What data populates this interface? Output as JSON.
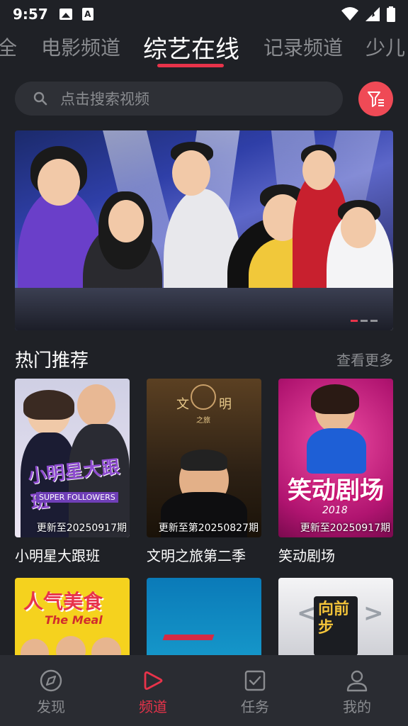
{
  "status": {
    "time": "9:57"
  },
  "tabs": [
    {
      "label": "全"
    },
    {
      "label": "电影频道"
    },
    {
      "label": "综艺在线",
      "active": true
    },
    {
      "label": "记录频道"
    },
    {
      "label": "少儿"
    }
  ],
  "search": {
    "placeholder": "点击搜索视频"
  },
  "banner": {
    "slides": 3,
    "active_slide": 1
  },
  "section": {
    "title": "热门推荐",
    "more": "查看更多"
  },
  "cards_row1": [
    {
      "title": "小明星大跟班",
      "badge": "更新至20250917期"
    },
    {
      "title": "文明之旅第二季",
      "badge": "更新至第20250827期"
    },
    {
      "title": "笑动剧场",
      "badge": "更新至20250917期"
    }
  ],
  "posters": {
    "p1_cn": "小明星大跟班",
    "p1_en": "SUPER FOLLOWERS",
    "p2_title_a": "文",
    "p2_title_b": "明",
    "p2_sub": "之旅",
    "p3_title": "笑动剧场",
    "p3_year": "2018",
    "p4_title": "人气美食",
    "p4_en": "The Meal",
    "p6_title": "向前步"
  },
  "nav": [
    {
      "label": "发现"
    },
    {
      "label": "频道",
      "active": true
    },
    {
      "label": "任务"
    },
    {
      "label": "我的"
    }
  ],
  "colors": {
    "accent": "#e8334a",
    "background": "#1f2126"
  }
}
